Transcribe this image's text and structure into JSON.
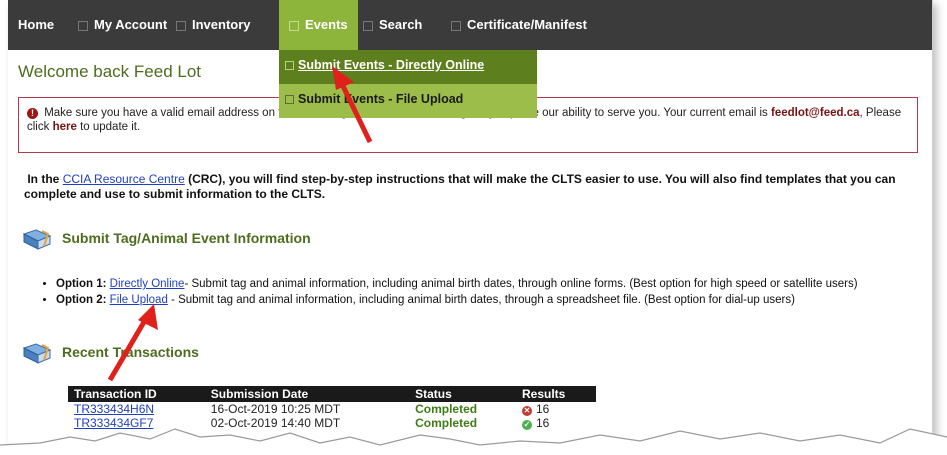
{
  "nav": {
    "items": [
      {
        "label": "Home"
      },
      {
        "label": "My Account"
      },
      {
        "label": "Inventory"
      },
      {
        "label": "Events"
      },
      {
        "label": "Search"
      },
      {
        "label": "Certificate/Manifest"
      }
    ]
  },
  "dropdown": {
    "items": [
      {
        "label": "Submit Events - Directly Online"
      },
      {
        "label": "Submit Events - File Upload"
      }
    ]
  },
  "welcome": "Welcome back  Feed Lot",
  "alert": {
    "text1": "Make sure you have a valid email address on file. Providing an email address will greatly improve our ability to serve you. Your current email is",
    "email": "feedlot@feed.ca",
    "text2": ", Please click",
    "here": "here",
    "text3": "to update it."
  },
  "crc": {
    "pre": "In the",
    "link": "CCIA Resource Centre",
    "post": "(CRC), you will find step-by-step instructions that will make the CLTS easier to use. You will also find templates that you can complete and use to submit information to the CLTS."
  },
  "section_submit": "Submit Tag/Animal Event Information",
  "options": [
    {
      "label": "Option 1:",
      "link": "Directly Online",
      "desc": "- Submit tag and animal information, including animal birth dates, through online forms. (Best option for high speed or satellite users)"
    },
    {
      "label": "Option 2:",
      "link": "File Upload",
      "desc": "- Submit tag and animal information, including animal birth dates, through a spreadsheet file. (Best option for dial-up users)"
    }
  ],
  "section_recent": "Recent Transactions",
  "table": {
    "headers": [
      "Transaction ID",
      "Submission Date",
      "Status",
      "Results"
    ],
    "rows": [
      {
        "id": "TR333434H6N",
        "date": "16-Oct-2019 10:25 MDT",
        "status": "Completed",
        "result": "16",
        "icon": "error-icon"
      },
      {
        "id": "TR333434GF7",
        "date": "02-Oct-2019 14:40 MDT",
        "status": "Completed",
        "result": "16",
        "icon": "check-icon"
      }
    ]
  },
  "colors": {
    "nav_bg": "#3b3b3b",
    "accent_green": "#8db53c",
    "dark_green": "#5e7f1e",
    "heading_green": "#4f6c1e",
    "alert_border": "#b23a48",
    "arrow_red": "#e0201b"
  }
}
